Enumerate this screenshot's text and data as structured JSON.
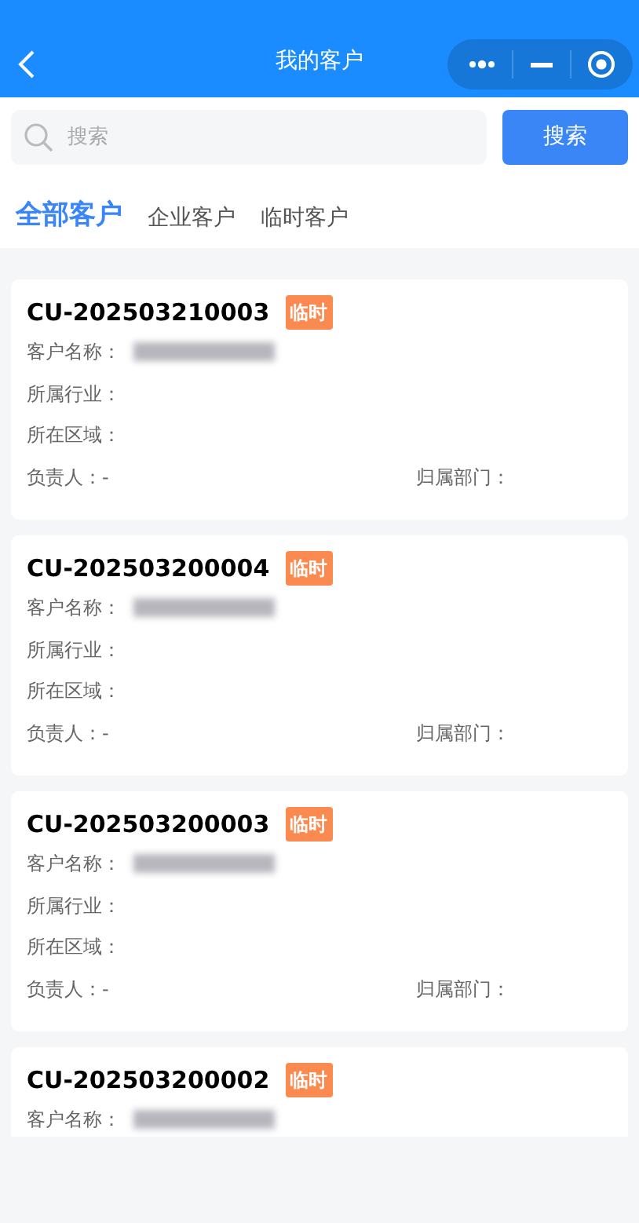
{
  "header": {
    "title": "我的客户"
  },
  "search": {
    "placeholder": "搜索",
    "button": "搜索"
  },
  "tabs": [
    {
      "label": "全部客户",
      "selected": true
    },
    {
      "label": "企业客户",
      "selected": false
    },
    {
      "label": "临时客户",
      "selected": false
    }
  ],
  "customers": [
    {
      "code": "CU-202503210003",
      "tag": "临时",
      "fields": [
        {
          "kind": "blurred",
          "label": "客户名称："
        },
        {
          "kind": "text",
          "label": "所属行业："
        },
        {
          "kind": "text",
          "label": "所在区域："
        },
        {
          "kind": "pair",
          "items": [
            {
              "label": "负责人：",
              "value": "-"
            },
            {
              "label": "归属部门："
            }
          ]
        }
      ]
    },
    {
      "code": "CU-202503200004",
      "tag": "临时",
      "fields": [
        {
          "kind": "blurred",
          "label": "客户名称："
        },
        {
          "kind": "text",
          "label": "所属行业："
        },
        {
          "kind": "text",
          "label": "所在区域："
        },
        {
          "kind": "pair",
          "items": [
            {
              "label": "负责人：",
              "value": "-"
            },
            {
              "label": "归属部门："
            }
          ]
        }
      ]
    },
    {
      "code": "CU-202503200003",
      "tag": "临时",
      "fields": [
        {
          "kind": "blurred",
          "label": "客户名称："
        },
        {
          "kind": "text",
          "label": "所属行业："
        },
        {
          "kind": "text",
          "label": "所在区域："
        },
        {
          "kind": "pair",
          "items": [
            {
              "label": "负责人：",
              "value": "-"
            },
            {
              "label": "归属部门："
            }
          ]
        }
      ]
    },
    {
      "code": "CU-202503200002",
      "tag": "临时",
      "fields": [
        {
          "kind": "blurred",
          "label": "客户名称："
        }
      ]
    }
  ]
}
